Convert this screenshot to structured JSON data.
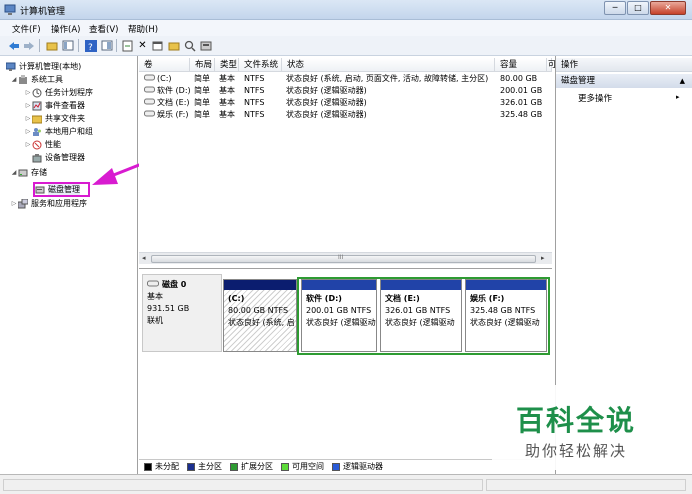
{
  "window": {
    "title": "计算机管理",
    "buttons": [
      "─",
      "□",
      "✕"
    ]
  },
  "menu": [
    "文件(F)",
    "操作(A)",
    "查看(V)",
    "帮助(H)"
  ],
  "toolbar": {
    "icons": [
      "back-icon",
      "forward-icon",
      "up-folder-icon",
      "show-tree-icon",
      "help-icon",
      "console-icon",
      "refresh-icon",
      "delete-icon",
      "properties-icon",
      "open-folder-icon",
      "search-icon",
      "disk-icon"
    ]
  },
  "tree": {
    "root": "计算机管理(本地)",
    "system_tools": "系统工具",
    "task_scheduler": "任务计划程序",
    "event_viewer": "事件查看器",
    "shared_folders": "共享文件夹",
    "local_users": "本地用户和组",
    "performance": "性能",
    "device_manager": "设备管理器",
    "storage": "存储",
    "disk_management": "磁盘管理",
    "services_apps": "服务和应用程序"
  },
  "volume_table": {
    "columns": [
      "卷",
      "布局",
      "类型",
      "文件系统",
      "状态",
      "容量",
      "可"
    ],
    "rows": [
      {
        "volume": "(C:)",
        "layout": "简单",
        "type": "基本",
        "fs": "NTFS",
        "status": "状态良好 (系统, 启动, 页面文件, 活动, 故障转储, 主分区)",
        "capacity": "80.00 GB"
      },
      {
        "volume": "软件 (D:)",
        "layout": "简单",
        "type": "基本",
        "fs": "NTFS",
        "status": "状态良好 (逻辑驱动器)",
        "capacity": "200.01 GB"
      },
      {
        "volume": "文档 (E:)",
        "layout": "简单",
        "type": "基本",
        "fs": "NTFS",
        "status": "状态良好 (逻辑驱动器)",
        "capacity": "326.01 GB"
      },
      {
        "volume": "娱乐 (F:)",
        "layout": "简单",
        "type": "基本",
        "fs": "NTFS",
        "status": "状态良好 (逻辑驱动器)",
        "capacity": "325.48 GB"
      }
    ],
    "scroll_mark": "III"
  },
  "disk": {
    "name": "磁盘 0",
    "type": "基本",
    "size": "931.51 GB",
    "state": "联机",
    "partitions": [
      {
        "name": "(C:)",
        "size": "80.00 GB NTFS",
        "status": "状态良好 (系统, 启"
      },
      {
        "name": "软件  (D:)",
        "size": "200.01 GB NTFS",
        "status": "状态良好 (逻辑驱动"
      },
      {
        "name": "文档  (E:)",
        "size": "326.01 GB NTFS",
        "status": "状态良好 (逻辑驱动"
      },
      {
        "name": "娱乐  (F:)",
        "size": "325.48 GB NTFS",
        "status": "状态良好 (逻辑驱动"
      }
    ]
  },
  "legend": [
    {
      "label": "未分配",
      "color": "#000000"
    },
    {
      "label": "主分区",
      "color": "#1b2f8f"
    },
    {
      "label": "扩展分区",
      "color": "#2e9b32"
    },
    {
      "label": "可用空间",
      "color": "#5ddc3a"
    },
    {
      "label": "逻辑驱动器",
      "color": "#2a5bd7"
    }
  ],
  "actions": {
    "header": "操作",
    "section": "磁盘管理",
    "more": "更多操作"
  },
  "watermark": {
    "line1": "百科全说",
    "line2": "助你轻松解决"
  },
  "colors": {
    "accent": "#d81bd0",
    "primary_partition": "#1b2f8f",
    "logical_drive": "#2143a8",
    "extended": "#2e9b32"
  }
}
